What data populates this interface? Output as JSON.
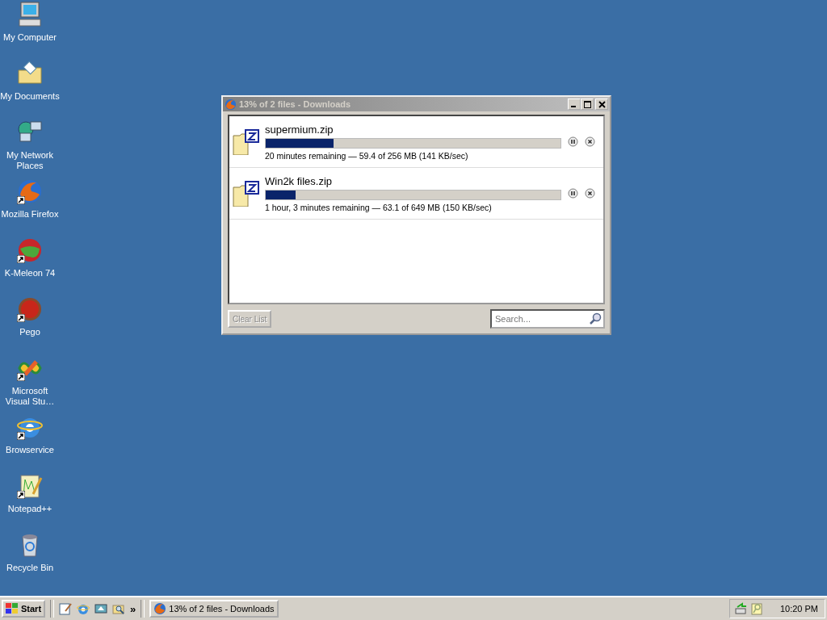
{
  "desktop_icons": [
    {
      "label": "My Computer",
      "shortcut": false
    },
    {
      "label": "My Documents",
      "shortcut": false
    },
    {
      "label": "My Network Places",
      "shortcut": false
    },
    {
      "label": "Mozilla Firefox",
      "shortcut": true
    },
    {
      "label": "K-Meleon 74",
      "shortcut": true
    },
    {
      "label": "Pego",
      "shortcut": true
    },
    {
      "label": "Microsoft Visual Stu…",
      "shortcut": true
    },
    {
      "label": "Browservice",
      "shortcut": true
    },
    {
      "label": "Notepad++",
      "shortcut": true
    },
    {
      "label": "Recycle Bin",
      "shortcut": false
    }
  ],
  "window": {
    "title": "13% of 2 files - Downloads",
    "downloads": [
      {
        "name": "supermium.zip",
        "level": 0.23,
        "status": "20 minutes remaining — 59.4 of 256 MB (141 KB/sec)"
      },
      {
        "name": "Win2k files.zip",
        "level": 0.1,
        "status": "1 hour, 3 minutes remaining — 63.1 of 649 MB (150 KB/sec)"
      }
    ],
    "clear_button": {
      "label": "Clear List",
      "disabled": true
    },
    "search": {
      "placeholder": "Search..."
    }
  },
  "taskbar": {
    "start": "Start",
    "more": "»",
    "tasks": [
      {
        "label": "13% of 2 files - Downloads",
        "selected": false
      }
    ],
    "clock": "10:20 PM"
  }
}
